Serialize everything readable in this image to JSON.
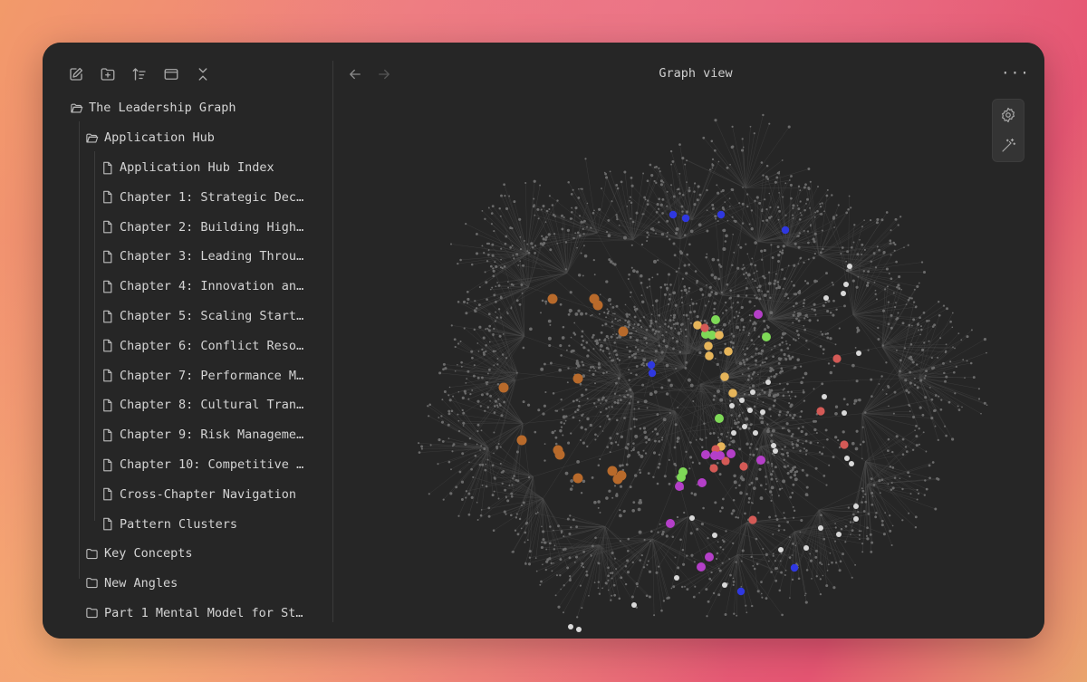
{
  "toolbar": {
    "icons": [
      "new-note-icon",
      "new-folder-icon",
      "sort-icon",
      "collapse-panel-icon",
      "collapse-all-icon"
    ]
  },
  "tree": {
    "vault": "The Leadership Graph",
    "folder_open": "Application Hub",
    "files": [
      "Application Hub Index",
      "Chapter 1: Strategic Dec…",
      "Chapter 2: Building High…",
      "Chapter 3: Leading Throu…",
      "Chapter 4: Innovation an…",
      "Chapter 5: Scaling Start…",
      "Chapter 6: Conflict Reso…",
      "Chapter 7: Performance M…",
      "Chapter 8: Cultural Tran…",
      "Chapter 9: Risk Manageme…",
      "Chapter 10: Competitive …",
      "Cross-Chapter Navigation",
      "Pattern Clusters"
    ],
    "folders": [
      "Key Concepts",
      "New Angles",
      "Part 1 Mental Model for St…"
    ]
  },
  "main": {
    "title": "Graph view",
    "more": "···"
  },
  "graph": {
    "colors": {
      "orange": "#b86a2b",
      "green": "#7ed957",
      "yellow": "#e6b55a",
      "red": "#d45a56",
      "purple": "#b43fc8",
      "blue": "#2f38e0",
      "white": "#d9d9d9",
      "node": "#6b6b6b",
      "edge": "#4a4a4a",
      "bg": "#262626"
    }
  }
}
